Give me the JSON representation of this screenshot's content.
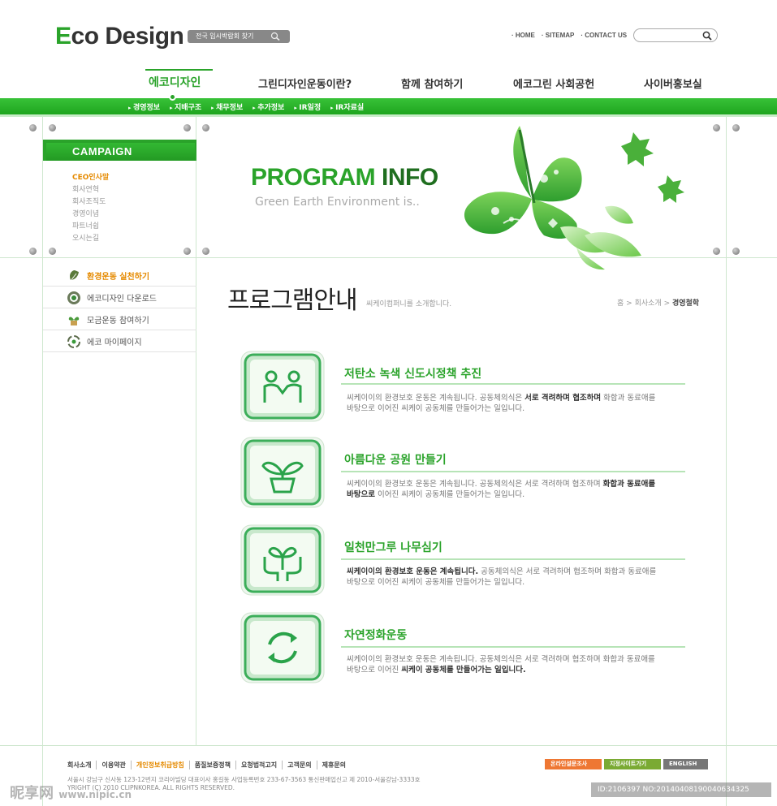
{
  "header": {
    "logo_first": "E",
    "logo_rest": "co Design",
    "search_pill": "전국 입시박람회 찾기",
    "top_links": [
      "HOME",
      "SITEMAP",
      "CONTACT US"
    ]
  },
  "nav": {
    "items": [
      "에코디자인",
      "그린디자인운동이란?",
      "함께 참여하기",
      "에코그린 사회공헌",
      "사이버홍보실"
    ],
    "subitems": [
      "경영정보",
      "지배구조",
      "채무정보",
      "추가정보",
      "IR일정",
      "IR자료실"
    ]
  },
  "sidebar": {
    "campaign_label": "CAMPAIGN",
    "submenu": [
      "CEO인사말",
      "회사연혁",
      "회사조직도",
      "경영이념",
      "파트너쉽",
      "오시는길"
    ],
    "menu": [
      {
        "label": "환경운동 실천하기",
        "icon": "leaf-icon"
      },
      {
        "label": "에코디자인 다운로드",
        "icon": "target-icon"
      },
      {
        "label": "모금운동 참여하기",
        "icon": "sprout-icon"
      },
      {
        "label": "에코 마이페이지",
        "icon": "recycle-icon"
      }
    ]
  },
  "banner": {
    "title_a": "PROGRAM",
    "title_b": " INFO",
    "subtitle": "Green Earth Environment is.."
  },
  "content": {
    "title": "프로그램안내",
    "desc": "씨케이컴퍼니를 소개합니다.",
    "crumb_home": "홈",
    "crumb_mid": "회사소개",
    "crumb_current": "경영철학"
  },
  "programs": [
    {
      "title": "저탄소 녹색 신도시정책 추진",
      "icon": "people-icon",
      "l1a": "씨케이이의 환경보호 운동은 계속됩니다. 공동체의식은 ",
      "l1b": "서로 격려하며 협조하며",
      "l1c": " 화합과 동료애를",
      "l2a": "바탕으로 이어진 씨케이 공동체를 만들어가는 일입니다.",
      "l2b": "",
      "l2c": ""
    },
    {
      "title": "아름다운 공원 만들기",
      "icon": "plant-pot-icon",
      "l1a": "씨케이이의 환경보호 운동은 계속됩니다. 공동체의식은 서로 격려하며 협조하며 ",
      "l1b": "화합과 동료애를",
      "l1c": "",
      "l2a": "",
      "l2b": "바탕으로",
      "l2c": " 이어진 씨케이 공동체를 만들어가는 일입니다."
    },
    {
      "title": "일천만그루 나무심기",
      "icon": "tree-hands-icon",
      "l1a": "",
      "l1b": "씨케이이의 환경보호 운동은 계속됩니다.",
      "l1c": " 공동체의식은 서로 격려하며 협조하며 화합과 동료애를",
      "l2a": "바탕으로 이어진 씨케이 공동체를 만들어가는 일입니다.",
      "l2b": "",
      "l2c": ""
    },
    {
      "title": "자연정화운동",
      "icon": "recycle-icon",
      "l1a": "씨케이이의 환경보호 운동은 계속됩니다. 공동체의식은 서로 격려하며 협조하며 화합과 동료애를",
      "l1b": "",
      "l1c": "",
      "l2a": "바탕으로 이어진 ",
      "l2b": "씨케이 공동체를 만들어가는 일입니다.",
      "l2c": ""
    }
  ],
  "footer": {
    "links": [
      "회사소개",
      "이용약관",
      "개인정보취급방침",
      "품질보증정책",
      "요청법적고지",
      "고객문의",
      "제휴문의"
    ],
    "address": "서울시 강남구 신사동 123-12번지 코리아빌딩  대표이사 홍길동 사업등록번호 233-67-3563 통신판매업신고 제 2010-서울강남-3333호",
    "copyright": "YRIGHT (C) 2010 CLIPNKOREA. ALL RIGHTS RESERVED.",
    "buttons": [
      "온라인설문조사",
      "지정사이트가기",
      "ENGLISH"
    ]
  },
  "watermark": {
    "logo": "昵享网",
    "url": "www.nipic.cn",
    "id": "ID:2106397 NO:20140408190040634325"
  },
  "colors": {
    "brand_green": "#2aa32a",
    "accent_orange": "#e58a00"
  }
}
